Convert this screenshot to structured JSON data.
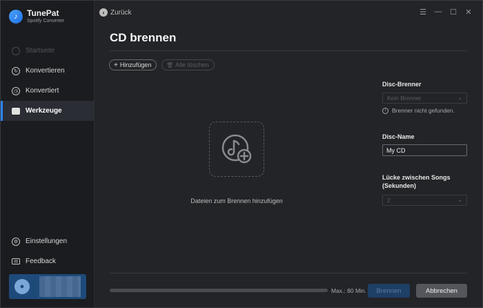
{
  "app": {
    "name": "TunePat",
    "subtitle": "Spotify Converter"
  },
  "sidebar": {
    "items": [
      {
        "label": "Startseite",
        "icon": "home-icon",
        "state": "disabled"
      },
      {
        "label": "Konvertieren",
        "icon": "convert-icon",
        "state": "normal"
      },
      {
        "label": "Konvertiert",
        "icon": "clock-icon",
        "state": "normal"
      },
      {
        "label": "Werkzeuge",
        "icon": "toolbox-icon",
        "state": "active"
      }
    ],
    "bottom_items": [
      {
        "label": "Einstellungen",
        "icon": "gear-icon"
      },
      {
        "label": "Feedback",
        "icon": "mail-icon"
      }
    ]
  },
  "topbar": {
    "back_label": "Zurück",
    "controls": [
      "menu-icon",
      "minimize-icon",
      "maximize-icon",
      "close-icon"
    ]
  },
  "main": {
    "title": "CD brennen",
    "add_label": "Hinzufügen",
    "clear_label": "Alle löschen",
    "drop_hint": "Dateien zum Brennen hinzufügen"
  },
  "panel": {
    "burner_label": "Disc-Brenner",
    "burner_value": "Kein Brenner",
    "burner_info": "Brenner nicht gefunden.",
    "disc_name_label": "Disc-Name",
    "disc_name_value": "My CD",
    "gap_label_1": "Lücke zwischen Songs",
    "gap_label_2": "(Sekunden)",
    "gap_value": "2"
  },
  "footer": {
    "progress_fraction": 0,
    "max_label": "Max.: 80 Min.",
    "burn_label": "Brennen",
    "cancel_label": "Abbrechen"
  },
  "colors": {
    "accent": "#2f86ff",
    "background": "#232427",
    "sidebar": "#1b1c1f"
  }
}
